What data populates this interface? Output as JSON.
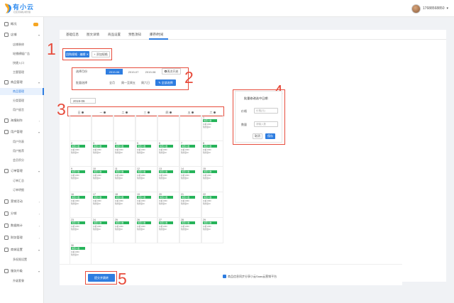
{
  "header": {
    "logo_name": "有小云",
    "logo_sub": "社区营销私域管理",
    "phone": "17688568850",
    "dropdown": "▾"
  },
  "sidebar": {
    "items": [
      {
        "label": "概况",
        "badge": "",
        "has_badge": false
      },
      {
        "label": "店铺",
        "arrow": "▾"
      },
      {
        "label": "商品管理",
        "arrow": "▾"
      },
      {
        "label": "海报制作",
        "arrow": "›"
      },
      {
        "label": "用户管理",
        "arrow": "▾"
      },
      {
        "label": "订单管理",
        "arrow": "▾"
      },
      {
        "label": "营销活动",
        "arrow": "›"
      },
      {
        "label": "分销",
        "arrow": "›"
      },
      {
        "label": "数据统计",
        "arrow": "›"
      },
      {
        "label": "财务管理",
        "arrow": "›"
      },
      {
        "label": "商城设置",
        "arrow": "▾"
      },
      {
        "label": "服务升级",
        "arrow": "▾"
      }
    ],
    "subs": [
      "店铺装修",
      "轮播横幅广告",
      "快捷入口",
      "主题管理",
      "商品管理",
      "分类管理",
      "用户留言",
      "用户列表",
      "用户推荐",
      "会员积分",
      "订单汇总",
      "订单明细",
      "多权限设置",
      "升级套餐"
    ]
  },
  "tabs": [
    "基础信息",
    "图文详情",
    "商品设置",
    "预售须知",
    "库存/时间"
  ],
  "toolbar": {
    "tag_label": "团购规格 · 编辑",
    "tag_close": "✕",
    "add_label": "+ 添加规格"
  },
  "date_row": {
    "label": "选择月份",
    "months": [
      "2019-06",
      "2019-07",
      "2019-08"
    ],
    "btn": "再次开启"
  },
  "batch_row": {
    "label": "批量选择",
    "options": [
      "全月",
      "周一至周五",
      "周六日"
    ],
    "btn": "全部选择"
  },
  "month_input": "2019-06",
  "weekdays": [
    "日",
    "一",
    "二",
    "三",
    "四",
    "五",
    "六"
  ],
  "calendar": {
    "tag": "拼团人数",
    "line1": "价格 1800",
    "line2": "预约量10",
    "days": [
      "1",
      "2",
      "3",
      "4",
      "5",
      "6",
      "7",
      "8",
      "9",
      "10",
      "11",
      "12",
      "13",
      "14",
      "15",
      "16",
      "17",
      "18",
      "19",
      "20",
      "21",
      "22",
      "23",
      "24",
      "25",
      "26",
      "27",
      "28",
      "29",
      "30"
    ]
  },
  "dialog": {
    "title": "批量修改选中日期",
    "price_label": "价格",
    "price_ph": "价格(元)",
    "stock_label": "数量",
    "stock_ph": "请输入数",
    "cancel": "取消",
    "ok": "保存"
  },
  "footer": {
    "submit": "提交并跳转",
    "checkbox_label": "商品信息同步分享小云Saas云营销平台"
  },
  "annotations": [
    "1",
    "2",
    "3",
    "4",
    "5"
  ],
  "colors": {
    "primary": "#2e7de0",
    "red": "#e74c3c",
    "green": "#26b45a"
  }
}
